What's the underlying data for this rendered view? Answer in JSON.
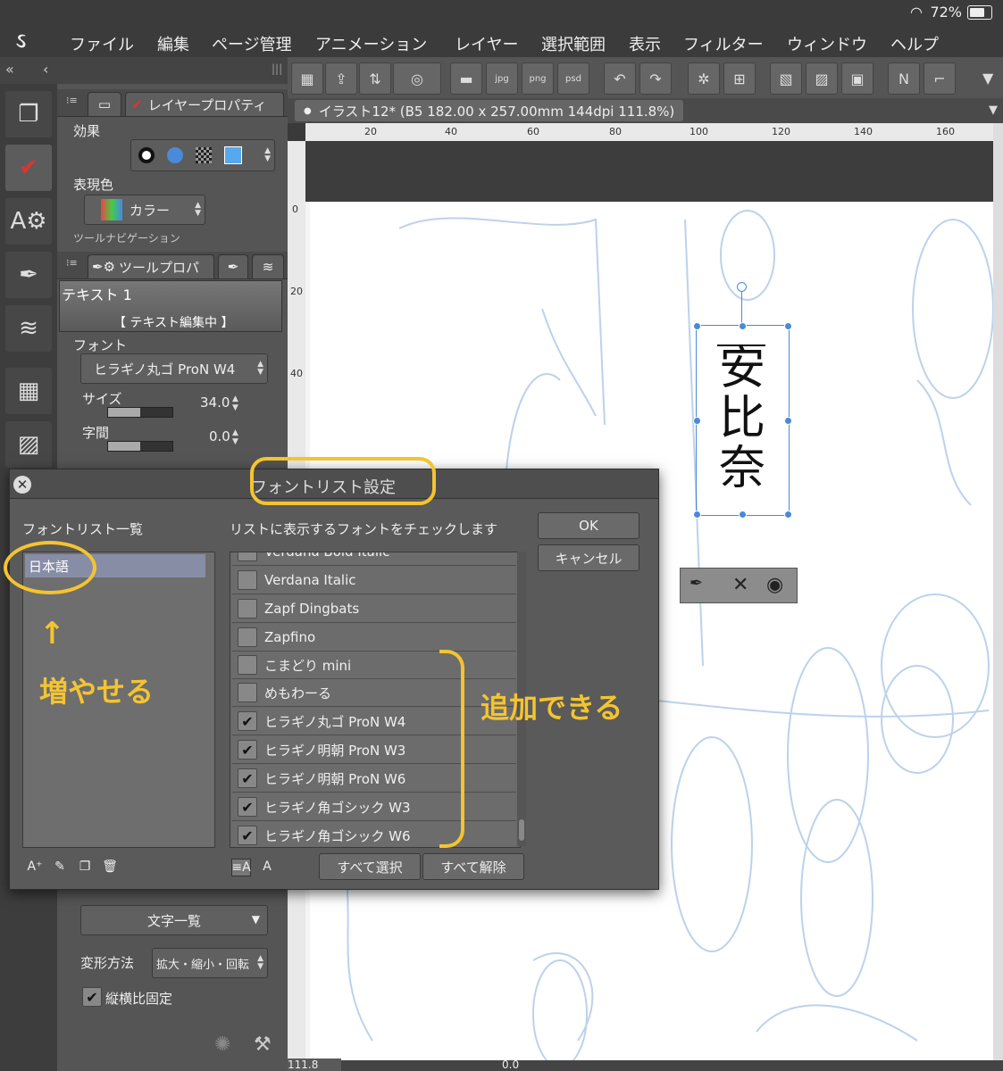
{
  "status": {
    "battery_pct": "72%"
  },
  "menu": [
    "ファイル",
    "編集",
    "ページ管理",
    "アニメーション",
    "レイヤー",
    "選択範囲",
    "表示",
    "フィルター",
    "ウィンドウ",
    "ヘルプ"
  ],
  "palette": {
    "tab_layer_prop": "レイヤープロパティ",
    "effect_label": "効果",
    "color_label": "表現色",
    "color_value": "カラー",
    "toolnav_label": "ツールナビゲーション",
    "tab_tool_prop": "ツールプロパ",
    "tool_name": "テキスト 1",
    "editing_status": "【 テキスト編集中 】",
    "font_label": "フォント",
    "font_value": "ヒラギノ丸ゴ ProN W4",
    "size_label": "サイズ",
    "size_value": "34.0",
    "spacing_label": "字間",
    "spacing_value": "0.0",
    "char_list": "文字一覧",
    "transform_label": "変形方法",
    "transform_value": "拡大・縮小・回転",
    "lock_ratio_label": "縦横比固定"
  },
  "document": {
    "tab_title": "イラスト12* (B5 182.00 x 257.00mm 144dpi 111.8%)",
    "zoom": "111.8",
    "angle": "0.0",
    "ruler_h": [
      "20",
      "40",
      "60",
      "80",
      "100",
      "120",
      "140",
      "160"
    ],
    "ruler_v": [
      "0",
      "20",
      "40"
    ],
    "text_content": [
      "安",
      "比",
      "奈"
    ]
  },
  "dialog": {
    "title": "フォントリスト設定",
    "left_header": "フォントリスト一覧",
    "right_header": "リストに表示するフォントをチェックします",
    "lists": [
      "日本語"
    ],
    "ok": "OK",
    "cancel": "キャンセル",
    "select_all": "すべて選択",
    "deselect_all": "すべて解除",
    "fonts": [
      {
        "name": "Verdana Bold Italic",
        "checked": false
      },
      {
        "name": "Verdana Italic",
        "checked": false
      },
      {
        "name": "Zapf Dingbats",
        "checked": false
      },
      {
        "name": "Zapfino",
        "checked": false
      },
      {
        "name": "こまどり mini",
        "checked": false
      },
      {
        "name": "めもわーる",
        "checked": false
      },
      {
        "name": "ヒラギノ丸ゴ ProN W4",
        "checked": true
      },
      {
        "name": "ヒラギノ明朝 ProN W3",
        "checked": true
      },
      {
        "name": "ヒラギノ明朝 ProN W6",
        "checked": true
      },
      {
        "name": "ヒラギノ角ゴシック W3",
        "checked": true
      },
      {
        "name": "ヒラギノ角ゴシック W6",
        "checked": true
      }
    ]
  },
  "annotations": {
    "increase": "増やせる",
    "can_add": "追加できる"
  },
  "colors": {
    "accent_annotation": "#f4c430",
    "selection": "#4a8ad8"
  }
}
